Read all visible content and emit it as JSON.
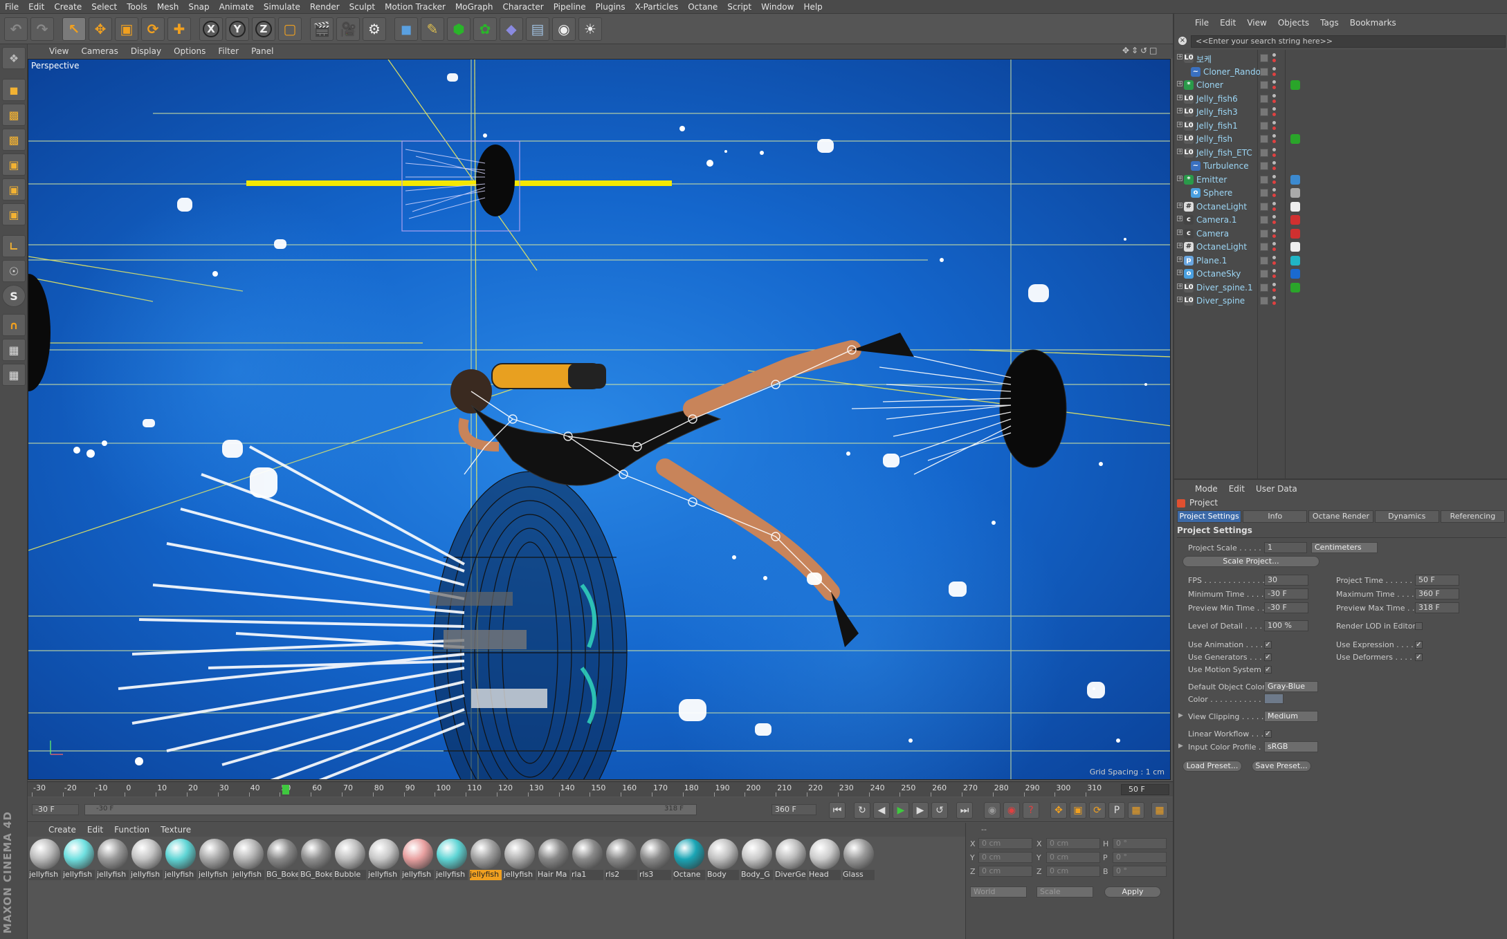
{
  "menubar": [
    "File",
    "Edit",
    "Create",
    "Select",
    "Tools",
    "Mesh",
    "Snap",
    "Animate",
    "Simulate",
    "Render",
    "Sculpt",
    "Motion Tracker",
    "MoGraph",
    "Character",
    "Pipeline",
    "Plugins",
    "X-Particles",
    "Octane",
    "Script",
    "Window",
    "Help"
  ],
  "toolbar": {
    "x_label": "X",
    "y_label": "Y",
    "z_label": "Z"
  },
  "viewport": {
    "menu": [
      "View",
      "Cameras",
      "Display",
      "Options",
      "Filter",
      "Panel"
    ],
    "label": "Perspective",
    "grid_spacing": "Grid Spacing : 1 cm"
  },
  "timeline": {
    "ticks": [
      "-30",
      "-20",
      "-10",
      "0",
      "10",
      "20",
      "30",
      "40",
      "50",
      "60",
      "70",
      "80",
      "90",
      "100",
      "110",
      "120",
      "130",
      "140",
      "150",
      "160",
      "170",
      "180",
      "190",
      "200",
      "210",
      "220",
      "230",
      "240",
      "250",
      "260",
      "270",
      "280",
      "290",
      "300",
      "310"
    ],
    "current_frame": "50 F",
    "start_field": "-30 F",
    "range_start": "-30 F",
    "range_end": "318 F",
    "end_field": "360 F"
  },
  "materials": {
    "menu": [
      "Create",
      "Edit",
      "Function",
      "Texture"
    ],
    "items": [
      {
        "name": "jellyfish",
        "color": "#bbbbbb"
      },
      {
        "name": "jellyfish",
        "color": "#6fe0e0"
      },
      {
        "name": "jellyfish",
        "color": "#9a9a9a"
      },
      {
        "name": "jellyfish",
        "color": "#c4c4c4"
      },
      {
        "name": "jellyfish",
        "color": "#5fd5d5"
      },
      {
        "name": "jellyfish",
        "color": "#a8a8a8"
      },
      {
        "name": "jellyfish",
        "color": "#b5b5b5"
      },
      {
        "name": "BG_Boke",
        "color": "#8a8a8a"
      },
      {
        "name": "BG_Boke",
        "color": "#8f8f8f"
      },
      {
        "name": "Bubble",
        "color": "#bdbdbd"
      },
      {
        "name": "jellyfish",
        "color": "#c8c8c8"
      },
      {
        "name": "jellyfish",
        "color": "#e8a0a0"
      },
      {
        "name": "jellyfish",
        "color": "#5fd5d5"
      },
      {
        "name": "jellyfish",
        "color": "#a0a0a0",
        "selected": true
      },
      {
        "name": "jellyfish",
        "color": "#b0b0b0"
      },
      {
        "name": "Hair Ma",
        "color": "#888888"
      },
      {
        "name": "rla1",
        "color": "#8a8a8a"
      },
      {
        "name": "rls2",
        "color": "#8a8a8a"
      },
      {
        "name": "rls3",
        "color": "#8a8a8a"
      },
      {
        "name": "Octane",
        "color": "#1aa5b5"
      },
      {
        "name": "Body",
        "color": "#c0c0c0"
      },
      {
        "name": "Body_G",
        "color": "#c8c8c8"
      },
      {
        "name": "DiverGe",
        "color": "#bbbbbb"
      },
      {
        "name": "Head",
        "color": "#cccccc"
      },
      {
        "name": "Glass",
        "color": "#9a9a9a"
      }
    ]
  },
  "coords": {
    "header": "--",
    "rows": [
      {
        "a": "X",
        "av": "0 cm",
        "b": "X",
        "bv": "0 cm",
        "c": "H",
        "cv": "0 °"
      },
      {
        "a": "Y",
        "av": "0 cm",
        "b": "Y",
        "bv": "0 cm",
        "c": "P",
        "cv": "0 °"
      },
      {
        "a": "Z",
        "av": "0 cm",
        "b": "Z",
        "bv": "0 cm",
        "c": "B",
        "cv": "0 °"
      }
    ],
    "world": "World",
    "scale": "Scale",
    "apply": "Apply"
  },
  "objects": {
    "menu": [
      "File",
      "Edit",
      "View",
      "Objects",
      "Tags",
      "Bookmarks"
    ],
    "search_placeholder": "<<Enter your search string here>>",
    "items": [
      {
        "name": "보케",
        "indent": 0,
        "icon": "L0",
        "tag": ""
      },
      {
        "name": "Cloner_Random",
        "indent": 1,
        "icon": "~",
        "tag": ""
      },
      {
        "name": "Cloner",
        "indent": 0,
        "icon": "*",
        "tag": "#2aa52a"
      },
      {
        "name": "Jelly_fish6",
        "indent": 0,
        "icon": "L0",
        "tag": ""
      },
      {
        "name": "Jelly_fish3",
        "indent": 0,
        "icon": "L0",
        "tag": ""
      },
      {
        "name": "Jelly_fish1",
        "indent": 0,
        "icon": "L0",
        "tag": ""
      },
      {
        "name": "Jelly_fish",
        "indent": 0,
        "icon": "L0",
        "tag": "#2aa52a"
      },
      {
        "name": "Jelly_fish_ETC",
        "indent": 0,
        "icon": "L0",
        "tag": ""
      },
      {
        "name": "Turbulence",
        "indent": 1,
        "icon": "~",
        "tag": ""
      },
      {
        "name": "Emitter",
        "indent": 0,
        "icon": "*",
        "tag": "#3c8ad0"
      },
      {
        "name": "Sphere",
        "indent": 1,
        "icon": "o",
        "tag": "#aaaaaa"
      },
      {
        "name": "OctaneLight",
        "indent": 0,
        "icon": "#",
        "tag": "#eeeeee"
      },
      {
        "name": "Camera.1",
        "indent": 0,
        "icon": "c",
        "tag": "#d03030"
      },
      {
        "name": "Camera",
        "indent": 0,
        "icon": "c",
        "tag": "#d03030"
      },
      {
        "name": "OctaneLight",
        "indent": 0,
        "icon": "#",
        "tag": "#eeeeee"
      },
      {
        "name": "Plane.1",
        "indent": 0,
        "icon": "p",
        "tag": "#20b5c5"
      },
      {
        "name": "OctaneSky",
        "indent": 0,
        "icon": "o",
        "tag": "#1a6ad0"
      },
      {
        "name": "Diver_spine.1",
        "indent": 0,
        "icon": "L0",
        "tag": "#2aa52a"
      },
      {
        "name": "Diver_spine",
        "indent": 0,
        "icon": "L0",
        "tag": ""
      }
    ]
  },
  "attributes": {
    "menu": [
      "Mode",
      "Edit",
      "User Data"
    ],
    "object": "Project",
    "tabs": [
      "Project Settings",
      "Info",
      "Octane Render",
      "Dynamics",
      "Referencing"
    ],
    "section": "Project Settings",
    "project_scale_label": "Project Scale . . . . .",
    "project_scale": "1",
    "scale_unit": "Centimeters",
    "scale_project_btn": "Scale Project...",
    "fps_label": "FPS . . . . . . . . . . . . . .",
    "fps": "30",
    "project_time_label": "Project Time . . . . . . .",
    "project_time": "50 F",
    "min_time_label": "Minimum Time . . . .",
    "min_time": "-30 F",
    "max_time_label": "Maximum Time . . . .",
    "max_time": "360 F",
    "preview_min_label": "Preview Min Time . . .",
    "preview_min": "-30 F",
    "preview_max_label": "Preview Max Time . . .",
    "preview_max": "318 F",
    "lod_label": "Level of Detail . . . . .",
    "lod": "100 %",
    "render_lod_label": "Render LOD in Editor",
    "use_animation": "Use Animation . . . . .",
    "use_expression": "Use Expression . . . . .",
    "use_generators": "Use Generators . . . .",
    "use_deformers": "Use Deformers . . . . .",
    "use_motion": "Use Motion System",
    "default_color_label": "Default Object Color",
    "default_color": "Gray-Blue",
    "color_label": "Color . . . . . . . . . . . .",
    "view_clipping_label": "View Clipping . . . . . .",
    "view_clipping": "Medium",
    "linear_workflow_label": "Linear Workflow . . . .",
    "input_profile_label": "Input Color Profile . . .",
    "input_profile": "sRGB",
    "load_preset": "Load Preset...",
    "save_preset": "Save Preset...",
    "check": "✓"
  },
  "brand": "MAXON CINEMA 4D"
}
